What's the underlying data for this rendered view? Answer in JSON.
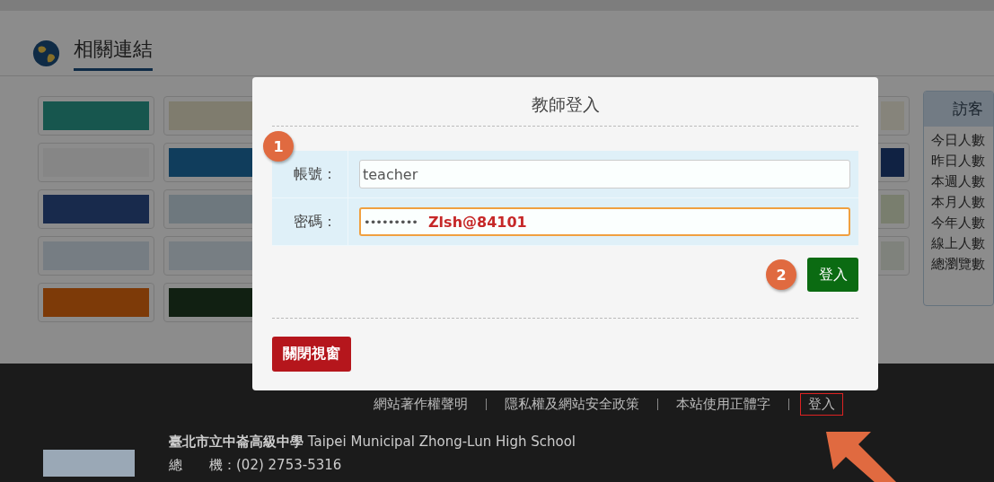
{
  "section": {
    "title": "相關連結"
  },
  "visitor_panel": {
    "title": "訪客",
    "items": [
      "今日人數",
      "昨日人數",
      "本週人數",
      "本月人數",
      "今年人數",
      "線上人數",
      "總瀏覽數"
    ]
  },
  "modal": {
    "title": "教師登入",
    "fields": [
      {
        "kind": "text",
        "step": "1",
        "label": "帳號：",
        "value": "teacher",
        "focused": false
      },
      {
        "kind": "password",
        "label": "密碼：",
        "masked_value": "•••••••••",
        "annotation": "Zlsh@84101",
        "focused": true
      }
    ],
    "login_step": "2",
    "login_button": "登入",
    "close_button": "關閉視窗"
  },
  "footer": {
    "links": [
      {
        "label": "網站著作權聲明",
        "highlighted": false
      },
      {
        "label": "隱私權及網站安全政策",
        "highlighted": false
      },
      {
        "label": "本站使用正體字",
        "highlighted": false
      },
      {
        "label": "登入",
        "highlighted": true
      }
    ],
    "school_name_bold": "臺北市立中崙高級中學",
    "school_name_en": "Taipei Municipal Zhong-Lun High School",
    "phone_label": "總　　機：",
    "phone": "(02) 2753-5316"
  }
}
